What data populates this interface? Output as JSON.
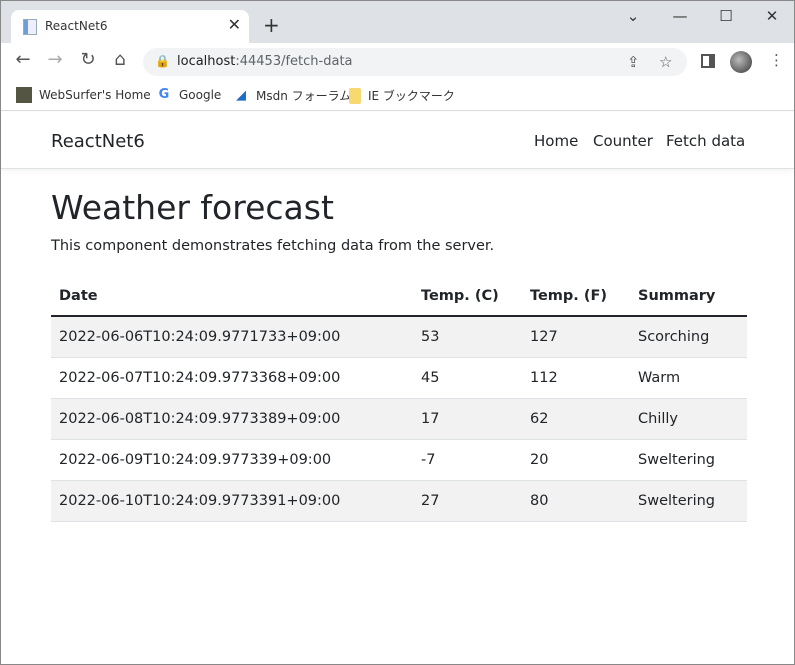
{
  "browser": {
    "tab_title": "ReactNet6",
    "url_host": "localhost",
    "url_rest": ":44453/fetch-data",
    "bookmarks": [
      {
        "label": "WebSurfer's Home",
        "icon": "site-icon"
      },
      {
        "label": "Google",
        "icon": "google-icon"
      },
      {
        "label": "Msdn フォーラム",
        "icon": "msdn-icon"
      },
      {
        "label": "IE ブックマーク",
        "icon": "folder-icon"
      }
    ]
  },
  "navbar": {
    "brand": "ReactNet6",
    "links": [
      "Home",
      "Counter",
      "Fetch data"
    ]
  },
  "main": {
    "title": "Weather forecast",
    "description": "This component demonstrates fetching data from the server.",
    "table": {
      "headers": [
        "Date",
        "Temp. (C)",
        "Temp. (F)",
        "Summary"
      ],
      "rows": [
        [
          "2022-06-06T10:24:09.9771733+09:00",
          "53",
          "127",
          "Scorching"
        ],
        [
          "2022-06-07T10:24:09.9773368+09:00",
          "45",
          "112",
          "Warm"
        ],
        [
          "2022-06-08T10:24:09.9773389+09:00",
          "17",
          "62",
          "Chilly"
        ],
        [
          "2022-06-09T10:24:09.977339+09:00",
          "-7",
          "20",
          "Sweltering"
        ],
        [
          "2022-06-10T10:24:09.9773391+09:00",
          "27",
          "80",
          "Sweltering"
        ]
      ]
    }
  }
}
